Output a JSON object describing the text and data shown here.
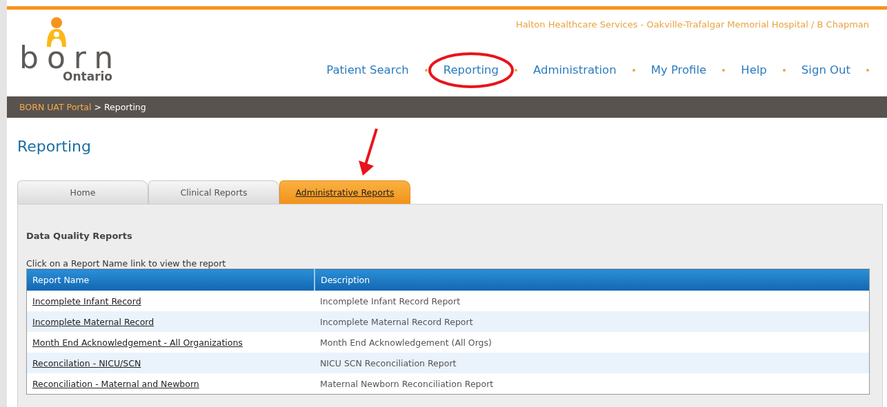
{
  "logo": {
    "wordmark": "born",
    "region": "Ontario"
  },
  "user_context": "Halton Healthcare Services - Oakville-Trafalgar Memorial Hospital / B Chapman",
  "nav": [
    {
      "label": "Patient Search"
    },
    {
      "label": "Reporting"
    },
    {
      "label": "Administration"
    },
    {
      "label": "My Profile"
    },
    {
      "label": "Help"
    },
    {
      "label": "Sign Out"
    }
  ],
  "breadcrumb": {
    "link": "BORN UAT Portal",
    "separator": ">",
    "current": "Reporting"
  },
  "page_title": "Reporting",
  "tabs": [
    {
      "label": "Home",
      "selected": false
    },
    {
      "label": "Clinical Reports",
      "selected": false
    },
    {
      "label": "Administrative Reports",
      "selected": true
    }
  ],
  "section_title": "Data Quality Reports",
  "instructions": "Click on a Report Name link to view the report",
  "table": {
    "columns": [
      "Report Name",
      "Description"
    ],
    "rows": [
      {
        "name": "Incomplete Infant Record",
        "description": "Incomplete Infant Record Report"
      },
      {
        "name": "Incomplete Maternal Record",
        "description": "Incomplete Maternal Record Report"
      },
      {
        "name": "Month End Acknowledgement - All Organizations",
        "description": "Month End Acknowledgement (All Orgs)"
      },
      {
        "name": "Reconcilation - NICU/SCN",
        "description": "NICU SCN Reconciliation Report"
      },
      {
        "name": "Reconciliation - Maternal and Newborn",
        "description": "Maternal Newborn Reconciliation Report"
      }
    ]
  }
}
